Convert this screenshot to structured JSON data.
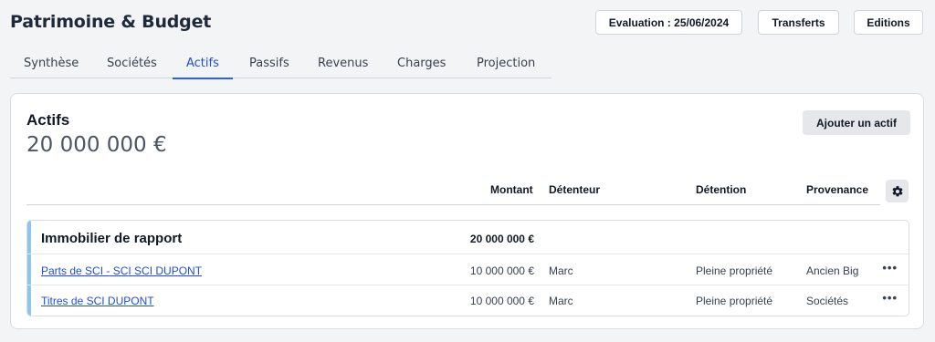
{
  "app": {
    "title": "Patrimoine & Budget"
  },
  "toolbar": {
    "evaluation_label": "Evaluation : 25/06/2024",
    "transferts_label": "Transferts",
    "editions_label": "Editions"
  },
  "tabs": [
    {
      "label": "Synthèse"
    },
    {
      "label": "Sociétés"
    },
    {
      "label": "Actifs",
      "active": true
    },
    {
      "label": "Passifs"
    },
    {
      "label": "Revenus"
    },
    {
      "label": "Charges"
    },
    {
      "label": "Projection"
    }
  ],
  "assets": {
    "title": "Actifs",
    "total": "20 000 000 €",
    "add_button": "Ajouter un actif",
    "columns": {
      "montant": "Montant",
      "detenteur": "Détenteur",
      "detention": "Détention",
      "provenance": "Provenance"
    },
    "group": {
      "name": "Immobilier de rapport",
      "amount": "20 000 000 €",
      "rows": [
        {
          "name": "Parts de SCI - SCI SCI DUPONT",
          "amount": "10 000 000 €",
          "holder": "Marc",
          "detention": "Pleine propriété",
          "provenance": "Ancien Big",
          "menu": "•••"
        },
        {
          "name": "Titres de SCI DUPONT",
          "amount": "10 000 000 €",
          "holder": "Marc",
          "detention": "Pleine propriété",
          "provenance": "Sociétés",
          "menu": "•••"
        }
      ]
    }
  },
  "icons": {
    "settings": "gear-icon",
    "row_menu": "more-horizontal-icon"
  },
  "colors": {
    "accent": "#2563eb",
    "group_bar": "#8ec5ee",
    "link": "#1d4ed8"
  }
}
